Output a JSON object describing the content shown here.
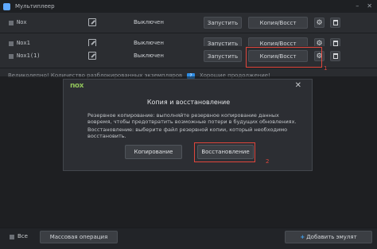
{
  "window": {
    "title": "Мультиплеер",
    "minimize": "–",
    "close": "✕"
  },
  "rows": [
    {
      "name": "Nox",
      "status": "Выключен",
      "run_label": "Запустить",
      "copy_label": "Копия/Восст"
    },
    {
      "name": "Nox1",
      "status": "Выключен",
      "run_label": "Запустить",
      "copy_label": "Копия/Восст"
    },
    {
      "name": "Nox1(1)",
      "status": "Выключен",
      "run_label": "Запустить",
      "copy_label": "Копия/Восст"
    }
  ],
  "annotations": {
    "marker_1": "1",
    "marker_2": "2",
    "highlight_color": "#e0463c"
  },
  "notice": {
    "text_before": "Великолепно! Количество разблокированных экземпляров",
    "badge": "?",
    "text_after": "Хорошие продолжение!"
  },
  "modal": {
    "logo": "nox",
    "close": "✕",
    "title": "Копия и восстановление",
    "backup_text": "Резервное копирование: выполняйте резервное копирование данных вовремя, чтобы предотвратить возможные потери в будущих обновлениях.",
    "restore_text": "Восстановление: выберите файл резервной копии, который необходимо восстановить.",
    "copy_button": "Копирование",
    "restore_button": "Восстановление"
  },
  "bottom": {
    "select_all": "Все",
    "bulk_button": "Массовая операция",
    "add_button_plus": "+",
    "add_button": "Добавить эмулят"
  },
  "colors": {
    "accent_blue": "#42a5f5",
    "nox_green": "#8fc15a"
  }
}
